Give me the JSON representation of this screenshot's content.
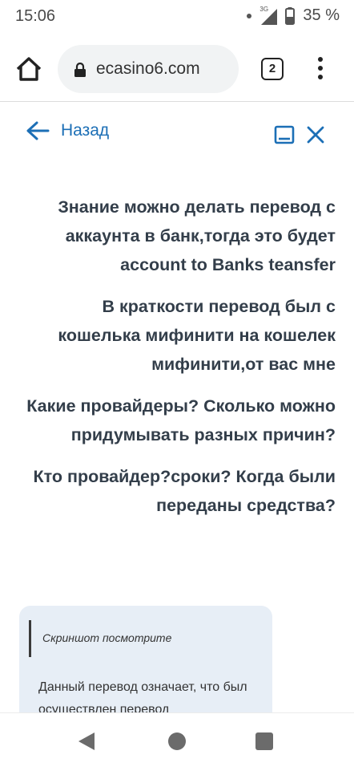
{
  "status_bar": {
    "time": "15:06",
    "network_label": "3G",
    "battery_percent": "35 %"
  },
  "browser": {
    "url": "ecasino6.com",
    "tab_count": "2"
  },
  "page_nav": {
    "back_label": "Назад"
  },
  "messages": [
    "Знание можно делать перевод с аккаунта в банк,тогда это будет account to Banks teansfer",
    "В краткости перевод был с кошелька мифинити на кошелек мифинити,от вас мне",
    "Какие провайдеры? Сколько можно придумывать разных причин?",
    "Кто провайдер?сроки? Когда были переданы средства?"
  ],
  "reply_card": {
    "quote": "Скриншот посмотрите",
    "text": "Данный перевод означает, что был осуществлен перевод"
  },
  "colors": {
    "accent": "#1c6fb6",
    "message_text": "#333e4a",
    "card_background": "#e7eef6"
  }
}
